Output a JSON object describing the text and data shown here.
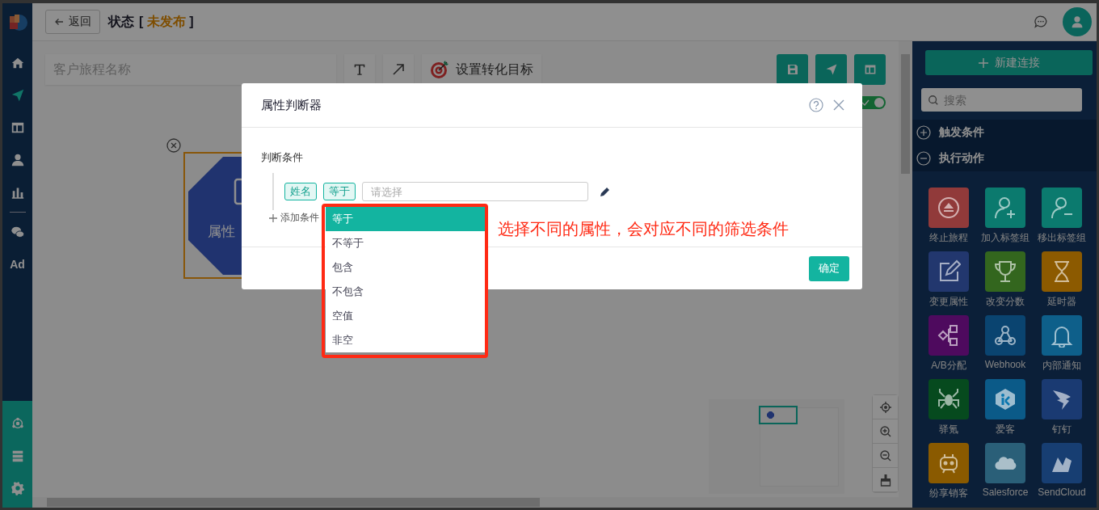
{
  "sidebar": {
    "items": [
      {
        "selected": false
      },
      {
        "selected": true
      },
      {
        "selected": false
      },
      {
        "selected": false
      },
      {
        "selected": false
      },
      {
        "selected": false
      },
      {
        "label": "Ad",
        "selected": false
      }
    ],
    "bottom_items": [
      {
        "selected": false
      },
      {
        "selected": false
      },
      {
        "selected": false
      }
    ]
  },
  "top_bar": {
    "back_button": "返回",
    "title": "状态",
    "status": "[ **未发布** ]"
  },
  "toolbar": {
    "name_placeholder": "客户旅程名称",
    "goal_button": "设置转化目标",
    "toggle": {
      "on": true
    }
  },
  "canvas": {
    "node": {
      "label": "属性",
      "selected": true
    }
  },
  "right_panel": {
    "new_button": "新建连接",
    "search_placeholder": "搜索",
    "sections": [
      {
        "label": "触发条件",
        "expanded": false
      },
      {
        "label": "执行动作",
        "expanded": true
      }
    ],
    "tiles": [
      {
        "label": "终止旅程",
        "color": "#913a3a"
      },
      {
        "label": "加入标签组",
        "color": "#0b7a6e"
      },
      {
        "label": "移出标签组",
        "color": "#0b7a6e"
      },
      {
        "label": "变更属性",
        "color": "#22376e"
      },
      {
        "label": "改变分数",
        "color": "#33661e"
      },
      {
        "label": "延时器",
        "color": "#8c5a00"
      },
      {
        "label": "A/B分配",
        "color": "#4e0a5e"
      },
      {
        "label": "Webhook",
        "color": "#0a4470"
      },
      {
        "label": "内部通知",
        "color": "#0e5f8a"
      },
      {
        "label": "驿氪",
        "color": "#064a1e"
      },
      {
        "label": "爱客",
        "color": "#0b5a88"
      },
      {
        "label": "钉钉",
        "color": "#1a3a72"
      },
      {
        "label": "纷享销客",
        "color": "#8a5a00"
      },
      {
        "label": "Salesforce",
        "color": "#2a5f78"
      },
      {
        "label": "SendCloud",
        "color": "#173e72"
      }
    ]
  },
  "dialog": {
    "title": "属性判断器",
    "section_label": "判断条件",
    "condition": {
      "attribute": "姓名",
      "operator": "等于",
      "value_placeholder": "请选择"
    },
    "add_label": "添加条件",
    "confirm_button": "确定",
    "dropdown": {
      "options": [
        {
          "label": "等于",
          "selected": true
        },
        {
          "label": "不等于",
          "selected": false
        },
        {
          "label": "包含",
          "selected": false
        },
        {
          "label": "不包含",
          "selected": false
        },
        {
          "label": "空值",
          "selected": false
        },
        {
          "label": "非空",
          "selected": false
        }
      ]
    },
    "annotation": "选择不同的属性，会对应不同的筛选条件"
  }
}
